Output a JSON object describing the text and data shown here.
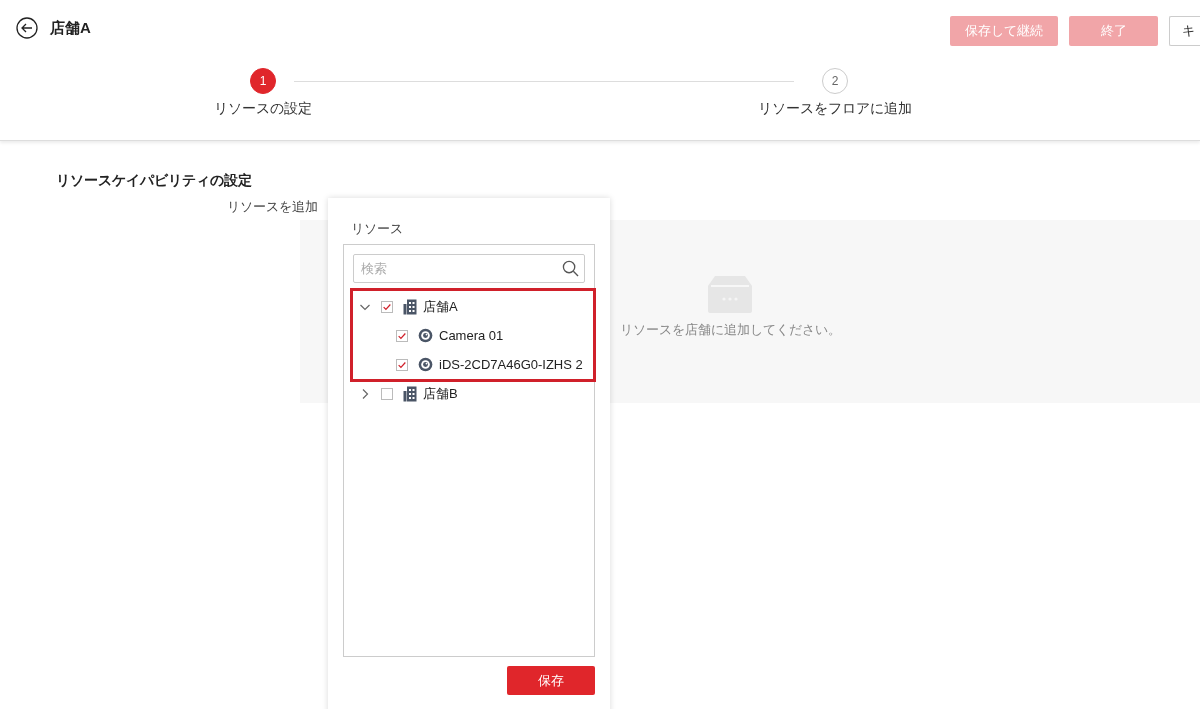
{
  "header": {
    "title": "店舗A",
    "buttons": [
      {
        "label": "保存して継続",
        "kind": "primary",
        "disabled": true
      },
      {
        "label": "終了",
        "kind": "primary",
        "disabled": true
      },
      {
        "label": "キ",
        "kind": "plain",
        "disabled": false
      }
    ]
  },
  "steps": [
    {
      "number": "1",
      "label": "リソースの設定",
      "selected": true
    },
    {
      "number": "2",
      "label": "リソースをフロアに追加",
      "selected": false
    }
  ],
  "section_title": "リソースケイパビリティの設定",
  "field_label": "リソースを追加",
  "empty_state": {
    "message": "リソースを店舗に追加してください。"
  },
  "resource_panel": {
    "title": "リソース",
    "search": {
      "placeholder": "検索"
    },
    "tree": [
      {
        "label": "店舗A",
        "kind": "site",
        "expanded": true,
        "checked": true,
        "highlighted": true,
        "children": [
          {
            "label": "Camera 01",
            "kind": "camera",
            "checked": true
          },
          {
            "label": "iDS-2CD7A46G0-IZHS 2",
            "kind": "camera",
            "checked": true
          }
        ]
      },
      {
        "label": "店舗B",
        "kind": "site",
        "expanded": false,
        "checked": false,
        "highlighted": false
      }
    ],
    "save_button": "保存"
  }
}
